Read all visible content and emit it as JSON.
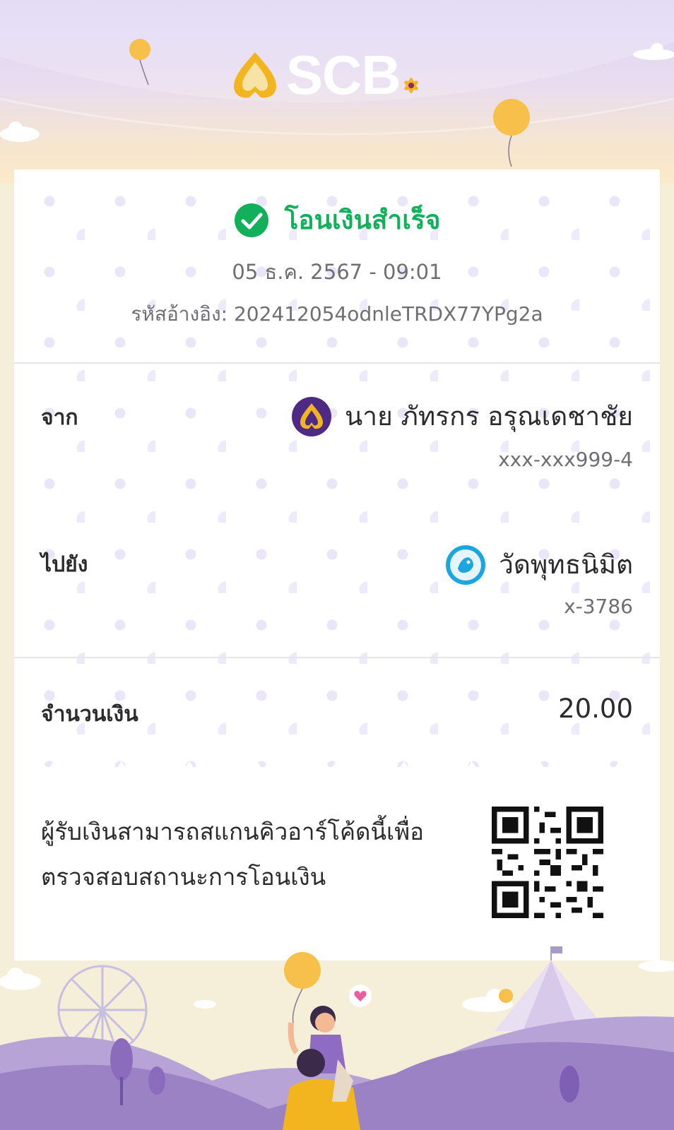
{
  "brand": {
    "name": "SCB",
    "primary": "#4e2a84",
    "accent": "#f2b51f",
    "success": "#12b05a"
  },
  "status": {
    "title": "โอนเงินสำเร็จ",
    "icon": "check-circle-icon"
  },
  "datetime": "05 ธ.ค. 2567  -  09:01",
  "reference": "รหัสอ้างอิง: 202412054odnleTRDX77YPg2a",
  "from": {
    "label": "จาก",
    "name": "นาย ภัทรกร อรุณเดชาชัย",
    "account": "xxx-xxx999-4",
    "bank_icon": "scb-bank-icon"
  },
  "to": {
    "label": "ไปยัง",
    "name": "วัดพุทธนิมิต",
    "account": "x-3786",
    "bank_icon": "ktb-bank-icon"
  },
  "amount": {
    "label": "จำนวนเงิน",
    "value": "20.00"
  },
  "qr_note": {
    "line1": "ผู้รับเงินสามารถสแกนคิวอาร์โค้ดนี้เพื่อ",
    "line2": "ตรวจสอบสถานะการโอนเงิน"
  }
}
